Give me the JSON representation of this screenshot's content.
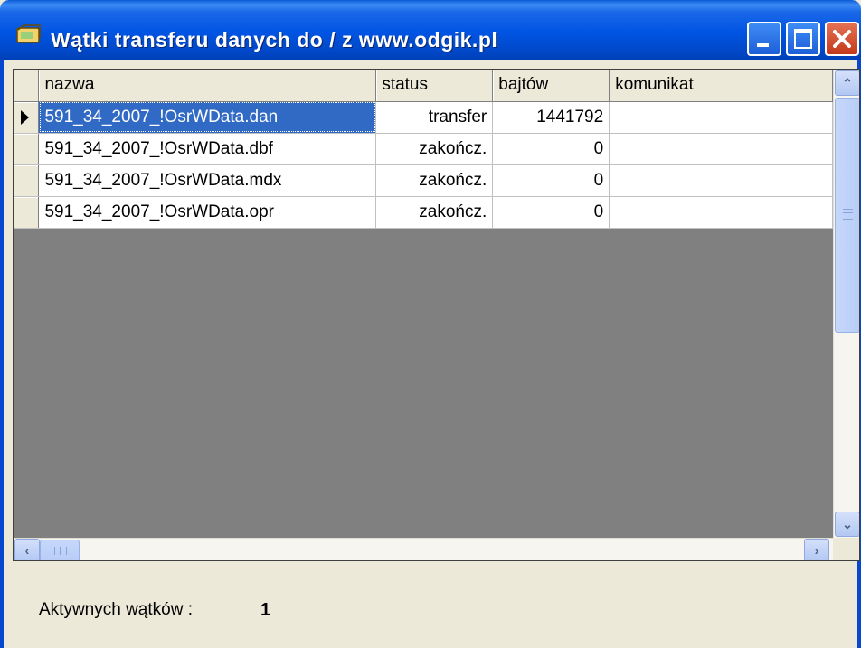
{
  "window": {
    "title": "Wątki transferu danych do / z  www.odgik.pl",
    "buttons": {
      "minimize_icon": "minimize-icon",
      "maximize_icon": "maximize-icon",
      "close_icon": "close-icon"
    }
  },
  "grid": {
    "columns": [
      "nazwa",
      "status",
      "bajtów",
      "komunikat"
    ],
    "rows": [
      {
        "nazwa": "591_34_2007_!OsrWData.dan",
        "status": "transfer",
        "bajtow": "1441792",
        "komunikat": ""
      },
      {
        "nazwa": "591_34_2007_!OsrWData.dbf",
        "status": "zakończ.",
        "bajtow": "0",
        "komunikat": ""
      },
      {
        "nazwa": "591_34_2007_!OsrWData.mdx",
        "status": "zakończ.",
        "bajtow": "0",
        "komunikat": ""
      },
      {
        "nazwa": "591_34_2007_!OsrWData.opr",
        "status": "zakończ.",
        "bajtow": "0",
        "komunikat": ""
      }
    ],
    "selected_row": 0
  },
  "status": {
    "label": "Aktywnych wątków :",
    "value": "1"
  },
  "colors": {
    "titlebar": "#0054e3",
    "selection": "#316ac5",
    "face": "#ece9d8"
  }
}
